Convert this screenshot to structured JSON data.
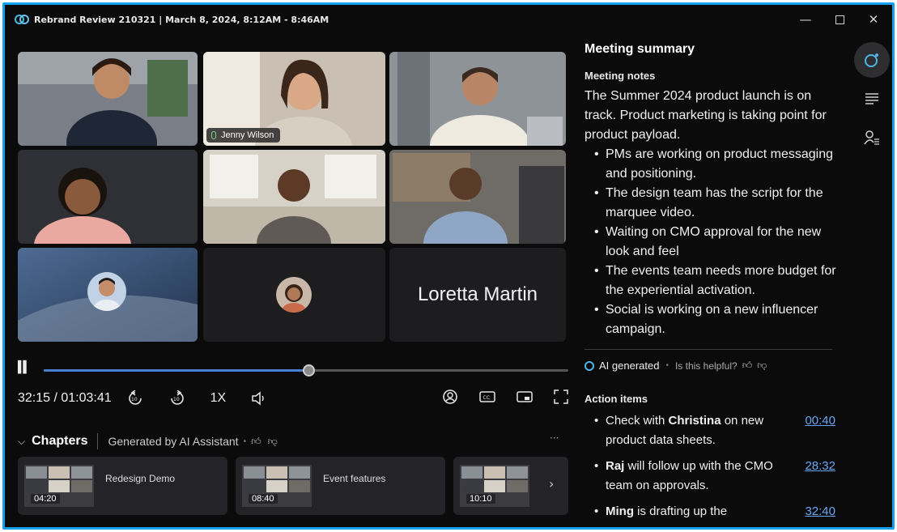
{
  "window": {
    "title": "Rebrand Review 210321 | March 8, 2024, 8:12AM - 8:46AM",
    "controls": [
      "minimize-icon",
      "maximize-icon",
      "close-icon"
    ]
  },
  "video": {
    "active_speaker": "Jenny Wilson",
    "name_only_tile": "Loretta Martin"
  },
  "playback": {
    "timecode": "32:15 / 01:03:41",
    "progress": 0.505,
    "rate": "1X",
    "buttons": [
      "pause-icon",
      "rewind-10-icon",
      "forward-10-icon",
      "volume-icon",
      "person-icon",
      "captions-icon",
      "pip-icon",
      "fullscreen-icon"
    ]
  },
  "chapters": {
    "title": "Chapters",
    "generated_by": "Generated by AI Assistant",
    "items": [
      {
        "label": "Redesign Demo",
        "time": "04:20"
      },
      {
        "label": "Event features",
        "time": "08:40"
      },
      {
        "label": "",
        "time": "10:10"
      }
    ]
  },
  "summary": {
    "title": "Meeting summary",
    "notes_title": "Meeting notes",
    "intro": "The Summer 2024 product launch is on track. Product marketing is taking point for product payload.",
    "bullets": [
      "PMs are working on product messaging and positioning.",
      "The design team has the script for the marquee video.",
      "Waiting on CMO approval for the new look and feel",
      "The events team needs more budget for the experiential activation.",
      "Social is working on a new influencer campaign."
    ],
    "ai_generated": "AI generated",
    "helpful": "Is this helpful?",
    "actions_title": "Action items",
    "actions": [
      {
        "pre": "Check with ",
        "who": "Christina",
        "post": " on new product data sheets.",
        "time": "00:40"
      },
      {
        "pre": "",
        "who": "Raj",
        "post": " will follow up with the CMO team on approvals.",
        "time": "28:32"
      },
      {
        "pre": "",
        "who": "Ming",
        "post": " is drafting up the",
        "time": "32:40"
      }
    ]
  },
  "colors": {
    "accent": "#13a0f0",
    "link": "#6aa6f4",
    "progress": "#4a7fd4",
    "speaker_outline": "#6fb7a3"
  }
}
